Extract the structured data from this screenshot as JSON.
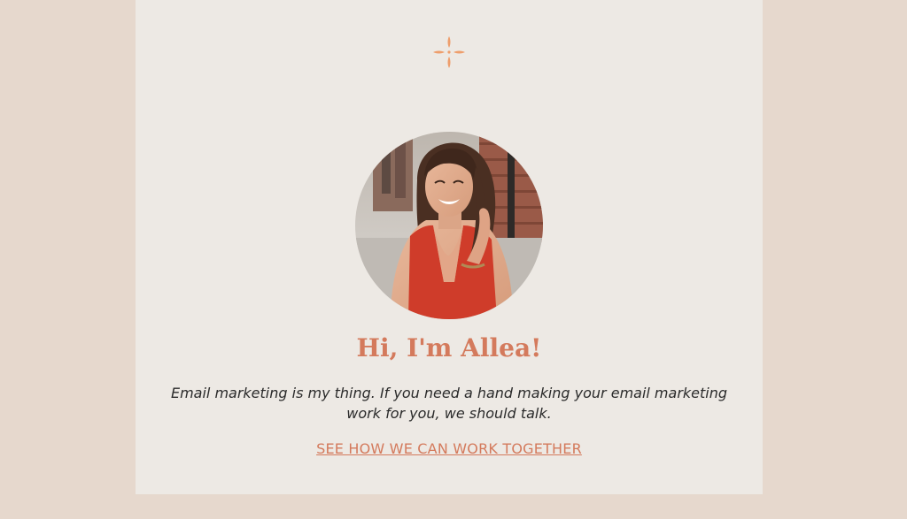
{
  "theme": {
    "page_background": "#e6d8cd",
    "card_background": "#ede9e4",
    "accent": "#d47a5c",
    "accent_logo": "#ee9e6c",
    "text": "#2b2b2b"
  },
  "logo": {
    "icon": "sparkle-logo-icon"
  },
  "profile": {
    "photo_icon": "profile-photo"
  },
  "greeting": "Hi, I'm Allea!",
  "intro": "Email marketing is my thing. If you need a hand making your email marketing work for you, we should talk.",
  "cta_link": "SEE HOW WE CAN WORK TOGETHER"
}
